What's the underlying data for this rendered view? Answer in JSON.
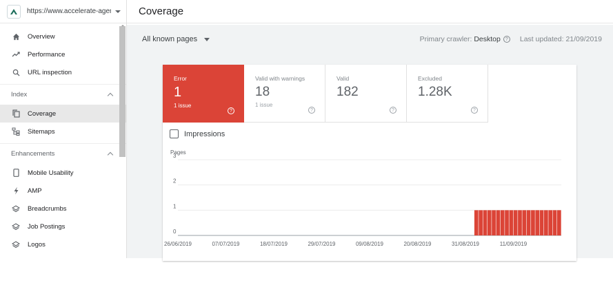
{
  "sidebar": {
    "property_url": "https://www.accelerate-agen...",
    "items_top": [
      {
        "label": "Overview",
        "icon": "home-icon"
      },
      {
        "label": "Performance",
        "icon": "trending-up-icon"
      },
      {
        "label": "URL inspection",
        "icon": "search-icon"
      }
    ],
    "index_section": "Index",
    "items_index": [
      {
        "label": "Coverage",
        "icon": "file-copy-icon",
        "active": true
      },
      {
        "label": "Sitemaps",
        "icon": "sitemap-icon"
      }
    ],
    "enhancements_section": "Enhancements",
    "items_enh": [
      {
        "label": "Mobile Usability",
        "icon": "smartphone-icon"
      },
      {
        "label": "AMP",
        "icon": "bolt-icon"
      },
      {
        "label": "Breadcrumbs",
        "icon": "layers-icon"
      },
      {
        "label": "Job Postings",
        "icon": "layers-icon"
      },
      {
        "label": "Logos",
        "icon": "layers-icon"
      }
    ]
  },
  "header": {
    "title": "Coverage"
  },
  "filter": {
    "pages": "All known pages",
    "crawler_label": "Primary crawler: ",
    "crawler_value": "Desktop",
    "updated_label": "Last updated: ",
    "updated_value": "21/09/2019"
  },
  "tiles": [
    {
      "label": "Error",
      "value": "1",
      "sub": "1 issue"
    },
    {
      "label": "Valid with warnings",
      "value": "18",
      "sub": "1 issue"
    },
    {
      "label": "Valid",
      "value": "182",
      "sub": ""
    },
    {
      "label": "Excluded",
      "value": "1.28K",
      "sub": ""
    }
  ],
  "impressions_label": "Impressions",
  "colors": {
    "error": "#db4437"
  },
  "chart_data": {
    "type": "bar",
    "ylabel": "Pages",
    "ylim": [
      0,
      3
    ],
    "yticks": [
      0,
      1,
      2,
      3
    ],
    "xticks": [
      "26/06/2019",
      "07/07/2019",
      "18/07/2019",
      "29/07/2019",
      "09/08/2019",
      "20/08/2019",
      "31/08/2019",
      "11/09/2019"
    ],
    "start_date": "2019-06-26",
    "end_date": "2019-09-21",
    "bars_from": "2019-09-02",
    "bar_value": 1
  }
}
